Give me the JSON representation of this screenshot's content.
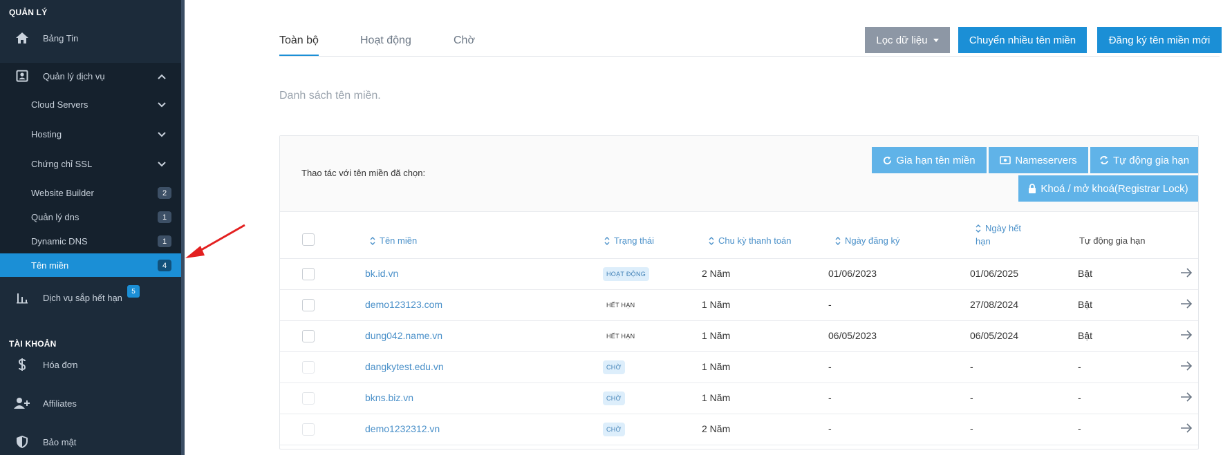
{
  "sidebar": {
    "section_manage": "QUẢN LÝ",
    "dashboard": "Bảng Tin",
    "service_mgmt": "Quản lý dịch vụ",
    "sub_items": [
      {
        "label": "Cloud Servers",
        "count": null,
        "chevron": true
      },
      {
        "label": "Hosting",
        "count": null,
        "chevron": true
      },
      {
        "label": "Chứng chỉ SSL",
        "count": null,
        "chevron": true
      },
      {
        "label": "Website Builder",
        "count": "2",
        "chevron": false
      },
      {
        "label": "Quản lý dns",
        "count": "1",
        "chevron": false
      },
      {
        "label": "Dynamic DNS",
        "count": "1",
        "chevron": false
      },
      {
        "label": "Tên miền",
        "count": "4",
        "chevron": false,
        "active": true
      }
    ],
    "expiring": "Dịch vụ sắp hết hạn",
    "expiring_count": "5",
    "section_account": "TÀI KHOẢN",
    "invoice": "Hóa đơn",
    "affiliates": "Affiliates",
    "security": "Bảo mật"
  },
  "tabs": {
    "all": "Toàn bộ",
    "active": "Hoạt động",
    "pending": "Chờ"
  },
  "toolbar": {
    "filter": "Lọc dữ liệu",
    "transfer": "Chuyển nhiều tên miền",
    "register": "Đăng ký tên miền mới"
  },
  "description": "Danh sách tên miền.",
  "bulk": {
    "label": "Thao tác với tên miền đã chọn:",
    "renew": "Gia hạn tên miền",
    "nameservers": "Nameservers",
    "auto_renew": "Tự động gia hạn",
    "lock": "Khoá / mở khoá(Registrar Lock)"
  },
  "table": {
    "headers": {
      "domain": "Tên miền",
      "status": "Trạng thái",
      "cycle": "Chu kỳ thanh toán",
      "reg_date": "Ngày đăng ký",
      "exp_date_1": "Ngày hết",
      "exp_date_2": "hạn",
      "auto_renew": "Tự động gia hạn"
    },
    "rows": [
      {
        "domain": "bk.id.vn",
        "status": "HOẠT ĐỘNG",
        "status_kind": "active",
        "cycle": "2 Năm",
        "reg": "01/06/2023",
        "exp": "01/06/2025",
        "auto": "Bật"
      },
      {
        "domain": "demo123123.com",
        "status": "HẾT HẠN",
        "status_kind": "expired",
        "cycle": "1 Năm",
        "reg": "-",
        "exp": "27/08/2024",
        "auto": "Bật"
      },
      {
        "domain": "dung042.name.vn",
        "status": "HẾT HẠN",
        "status_kind": "expired",
        "cycle": "1 Năm",
        "reg": "06/05/2023",
        "exp": "06/05/2024",
        "auto": "Bật"
      },
      {
        "domain": "dangkytest.edu.vn",
        "status": "CHỜ",
        "status_kind": "pending",
        "cycle": "1 Năm",
        "reg": "-",
        "exp": "-",
        "auto": "-"
      },
      {
        "domain": "bkns.biz.vn",
        "status": "CHỜ",
        "status_kind": "pending",
        "cycle": "1 Năm",
        "reg": "-",
        "exp": "-",
        "auto": "-"
      },
      {
        "domain": "demo1232312.vn",
        "status": "CHỜ",
        "status_kind": "pending",
        "cycle": "2 Năm",
        "reg": "-",
        "exp": "-",
        "auto": "-"
      }
    ]
  },
  "colors": {
    "sidebar_bg": "#1c2b3a",
    "accent": "#1b8fd6",
    "annotation_arrow": "#e32020"
  }
}
